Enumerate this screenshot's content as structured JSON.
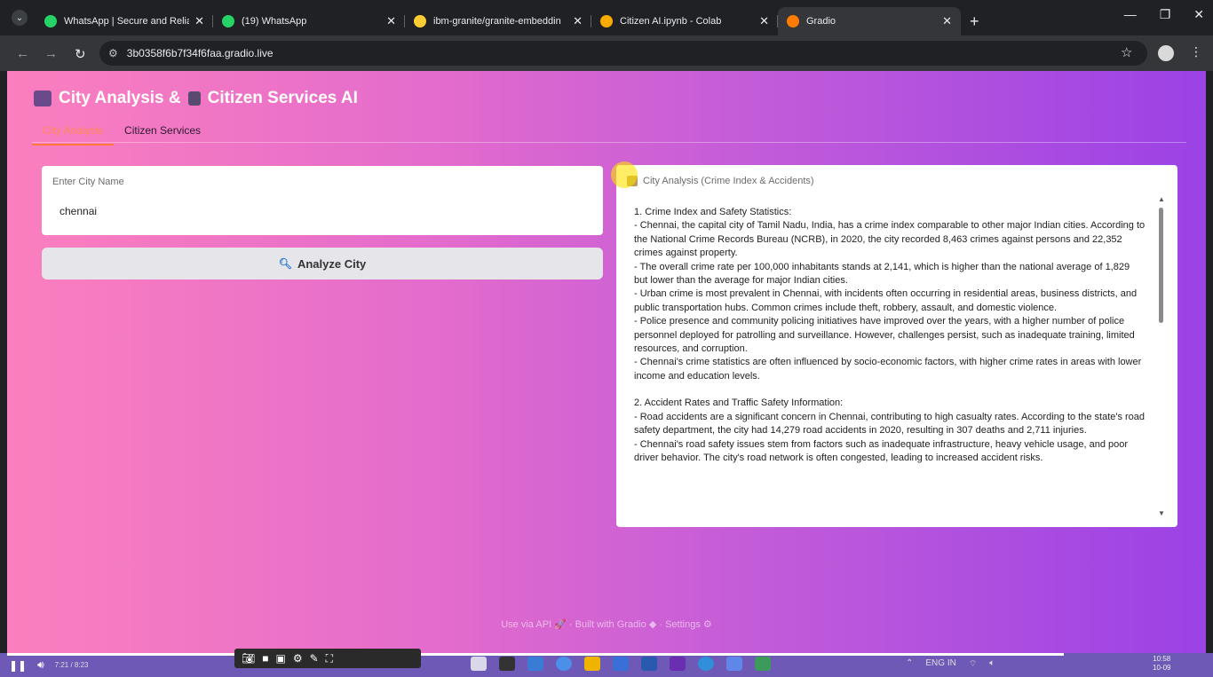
{
  "browser": {
    "tabs": [
      {
        "title": "WhatsApp | Secure and Reliable",
        "favicon_color": "#25d366",
        "active": false
      },
      {
        "title": "(19) WhatsApp",
        "favicon_color": "#25d366",
        "active": false
      },
      {
        "title": "ibm-granite/granite-embeddin",
        "favicon_color": "#ffcc33",
        "active": false
      },
      {
        "title": "Citizen AI.ipynb - Colab",
        "favicon_color": "#f9ab00",
        "active": false
      },
      {
        "title": "Gradio",
        "favicon_color": "#ff7c00",
        "active": true
      }
    ],
    "url": "3b0358f6b7f34f6faa.gradio.live"
  },
  "app": {
    "title_part1": "City Analysis &",
    "title_part2": "Citizen Services AI",
    "tabs": [
      {
        "label": "City Analysis",
        "selected": true
      },
      {
        "label": "Citizen Services",
        "selected": false
      }
    ]
  },
  "input": {
    "label": "Enter City Name",
    "value": "chennai"
  },
  "analyze_button": {
    "label": "Analyze City"
  },
  "output": {
    "label": "City Analysis (Crime Index & Accidents)",
    "paragraphs": [
      "1. Crime Index and Safety Statistics:",
      "   - Chennai, the capital city of Tamil Nadu, India, has a crime index comparable to other major Indian cities. According to the National Crime Records Bureau (NCRB), in 2020, the city recorded 8,463 crimes against persons and 22,352 crimes against property.",
      "   - The overall crime rate per 100,000 inhabitants stands at 2,141, which is higher than the national average of 1,829 but lower than the average for major Indian cities.",
      "   - Urban crime is most prevalent in Chennai, with incidents often occurring in residential areas, business districts, and public transportation hubs. Common crimes include theft, robbery, assault, and domestic violence.",
      "   - Police presence and community policing initiatives have improved over the years, with a higher number of police personnel deployed for patrolling and surveillance. However, challenges persist, such as inadequate training, limited resources, and corruption.",
      "   - Chennai's crime statistics are often influenced by socio-economic factors, with higher crime rates in areas with lower income and education levels.",
      "",
      "2. Accident Rates and Traffic Safety Information:",
      "   - Road accidents are a significant concern in Chennai, contributing to high casualty rates. According to the state's road safety department, the city had 14,279 road accidents in 2020, resulting in 307 deaths and 2,711 injuries.",
      "   - Chennai's road safety issues stem from factors such as inadequate infrastructure, heavy vehicle usage, and poor driver behavior. The city's road network is often congested, leading to increased accident risks."
    ]
  },
  "footer": {
    "api": "Use via API",
    "built": "Built with Gradio",
    "settings": "Settings",
    "sep": "·"
  },
  "player": {
    "time": "7:21 / 8:23"
  },
  "system": {
    "lang": "ENG IN",
    "clock_time": "10:58",
    "clock_date": "10-09"
  }
}
